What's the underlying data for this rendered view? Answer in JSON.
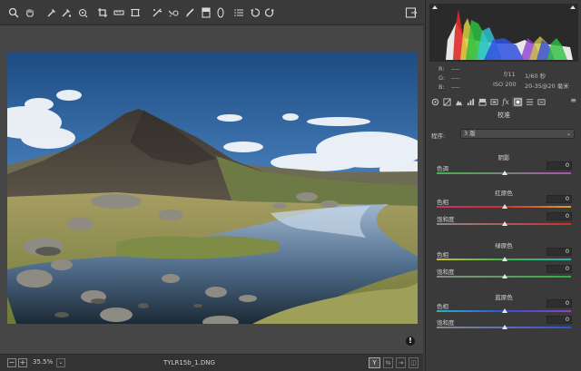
{
  "toolbar": {
    "icons": [
      "zoom-icon",
      "hand-icon",
      "white-balance-icon",
      "color-sampler-icon",
      "targeted-adjustment-icon",
      "crop-icon",
      "straighten-icon",
      "transform-icon",
      "spot-removal-icon",
      "red-eye-icon",
      "adjustment-brush-icon",
      "graduated-filter-icon",
      "radial-filter-icon",
      "preferences-icon",
      "rotate-left-icon",
      "rotate-right-icon"
    ],
    "exit_icon": "fullscreen-toggle-icon"
  },
  "histogram": {
    "rgb_labels": {
      "r": "R:",
      "g": "G:",
      "b": "B:"
    },
    "rgb_values": {
      "r": "----",
      "g": "----",
      "b": "----"
    },
    "aperture": "f/11",
    "shutter": "1/60 秒",
    "iso": "ISO 200",
    "lens": "20-35@20 毫米"
  },
  "tabs": [
    "basic",
    "tone-curve",
    "detail",
    "hsl",
    "split-toning",
    "lens",
    "effects",
    "camera-calibration",
    "presets",
    "snapshots"
  ],
  "panel": {
    "title": "校准",
    "profile_label": "程序:",
    "profile_value": "3 版",
    "shadows": {
      "title": "阴影",
      "tint_label": "色调",
      "tint_value": "0"
    },
    "red_primary": {
      "title": "红原色",
      "hue_label": "色相",
      "hue_value": "0",
      "sat_label": "饱和度",
      "sat_value": "0"
    },
    "green_primary": {
      "title": "绿原色",
      "hue_label": "色相",
      "hue_value": "0",
      "sat_label": "饱和度",
      "sat_value": "0"
    },
    "blue_primary": {
      "title": "蓝原色",
      "hue_label": "色相",
      "hue_value": "0",
      "sat_label": "饱和度",
      "sat_value": "0"
    }
  },
  "status": {
    "zoom_out": "−",
    "zoom_in": "+",
    "zoom": "35.5%",
    "filename": "TYLR15b_1.DNG",
    "view_y": "Y"
  },
  "colors": {
    "accent": "#ffffff",
    "panel": "#3a3a3a",
    "canvas": "#464646"
  }
}
